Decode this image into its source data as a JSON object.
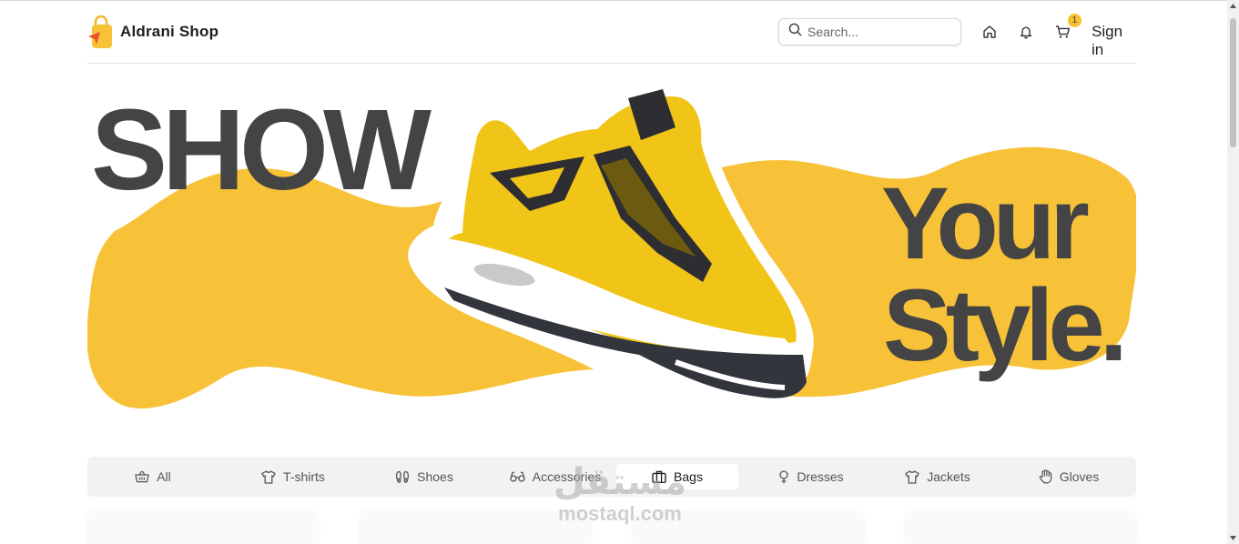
{
  "header": {
    "brand": "Aldrani Shop",
    "brand_icon": "shopping-bag-logo-icon",
    "search_placeholder": "Search...",
    "icons": [
      "home-icon",
      "bell-icon",
      "cart-icon"
    ],
    "cart_count": "1",
    "sign_in": "Sign in"
  },
  "hero": {
    "word1": "SHOW",
    "word2": "Your",
    "word3": "Style.",
    "accent_color": "#f8c238",
    "text_color": "#444444",
    "image": "yellow-sneaker-image"
  },
  "categories": [
    {
      "label": "All",
      "icon": "basket-icon"
    },
    {
      "label": "T-shirts",
      "icon": "tshirt-icon"
    },
    {
      "label": "Shoes",
      "icon": "footprints-icon"
    },
    {
      "label": "Accessories",
      "icon": "glasses-icon"
    },
    {
      "label": "Bags",
      "icon": "briefcase-icon"
    },
    {
      "label": "Dresses",
      "icon": "female-icon"
    },
    {
      "label": "Jackets",
      "icon": "jacket-icon"
    },
    {
      "label": "Gloves",
      "icon": "hand-icon"
    }
  ],
  "selected_category": "Bags",
  "watermark": {
    "arabic": "مستقل",
    "latin": "mostaql.com"
  }
}
